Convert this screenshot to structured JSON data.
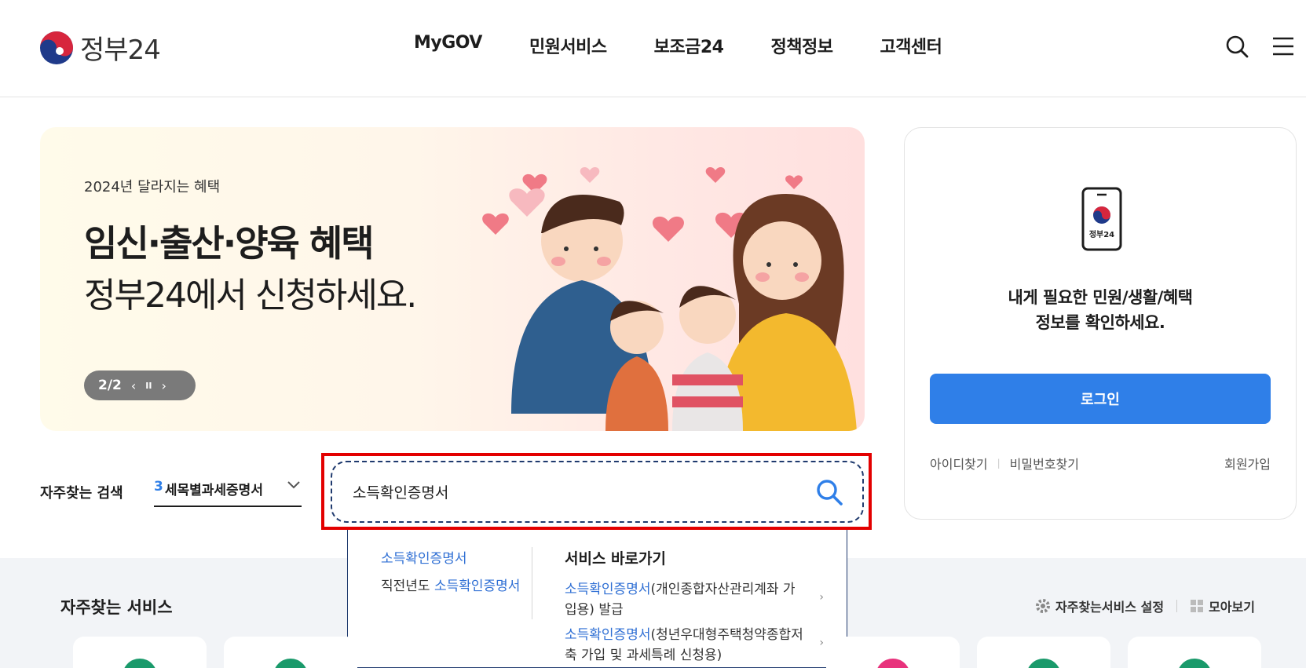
{
  "header": {
    "logo_text": "정부24",
    "nav": [
      "MyGOV",
      "민원서비스",
      "보조금24",
      "정책정보",
      "고객센터"
    ],
    "icons": [
      "search-icon",
      "hamburger-menu-icon"
    ]
  },
  "banner": {
    "kicker": "2024년 달라지는 혜택",
    "title": "임신·출산·양육 혜택",
    "subtitle": "정부24에서 신청하세요.",
    "counter": "2/2",
    "prev_icon": "‹",
    "pause_icon": "II",
    "next_icon": "›"
  },
  "login": {
    "app_label": "정부24",
    "message_line1": "내게 필요한 민원/생활/혜택",
    "message_line2": "정보를 확인하세요.",
    "login_button": "로그인",
    "find_id": "아이디찾기",
    "find_pw": "비밀번호찾기",
    "join": "회원가입"
  },
  "frequent_search": {
    "label": "자주찾는 검색",
    "rank": "3",
    "term": "세목별과세증명서"
  },
  "search": {
    "value": "소득확인증명서",
    "placeholder": ""
  },
  "autocomplete": {
    "suggestions": [
      {
        "prefix": "",
        "highlight": "소득확인증명서"
      },
      {
        "prefix": "직전년도 ",
        "highlight": "소득확인증명서"
      }
    ],
    "shortcut_heading": "서비스 바로가기",
    "shortcuts": [
      {
        "highlight": "소득확인증명서",
        "rest": "(개인종합자산관리계좌 가입용) 발급"
      },
      {
        "highlight": "소득확인증명서",
        "rest": "(청년우대형주택청약종합저축 가입 및 과세특례 신청용)"
      }
    ]
  },
  "services": {
    "title": "자주찾는 서비스",
    "settings_label": "자주찾는서비스 설정",
    "view_all_label": "모아보기",
    "colors": {
      "green": "#1a9a6b",
      "pink": "#e8327c"
    }
  },
  "colors": {
    "primary": "#2f7fe8",
    "highlight": "#2f6fd4",
    "outline_red": "#e30000",
    "navy": "#1f3a6e"
  }
}
